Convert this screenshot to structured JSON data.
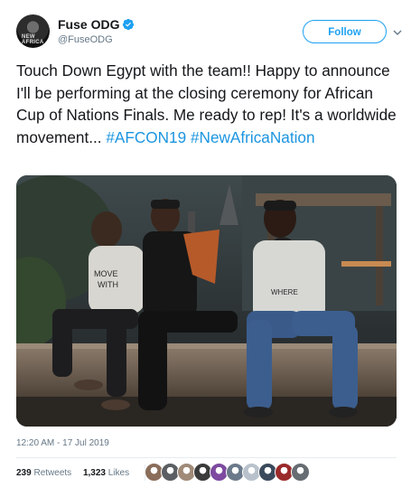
{
  "author": {
    "name": "Fuse ODG",
    "handle": "@FuseODG",
    "avatar_icon": "profile-photo-icon",
    "avatar_text": "NEW AFRICA",
    "verified_icon": "verified-badge-icon"
  },
  "follow_button": {
    "label": "Follow"
  },
  "menu": {
    "icon": "chevron-down-icon"
  },
  "tweet": {
    "text": "Touch Down Egypt with the team!! Happy to announce I'll be performing at the closing ceremony for African Cup of Nations Finals. Me ready to rep! It's a worldwide movement... ",
    "hashtags": [
      "#AFCON19",
      "#NewAfricaNation"
    ]
  },
  "photo": {
    "description_icon": "photo-three-men-sitting-on-ledge"
  },
  "meta": {
    "time": "12:20 AM - 17 Jul 2019"
  },
  "stats": {
    "retweets_count": "239",
    "retweets_label": "Retweets",
    "likes_count": "1,323",
    "likes_label": "Likes"
  },
  "likers": {
    "colors": [
      "#8a6d5a",
      "#5b5f63",
      "#a08a78",
      "#3b3b3b",
      "#7d4aa0",
      "#6b7a8a",
      "#b9c2cc",
      "#3a4a5c",
      "#9a2b2b",
      "#666d73"
    ]
  },
  "colors": {
    "accent": "#1da1f2",
    "hashtag": "#1b95e0",
    "text": "#14171a",
    "muted": "#657786"
  }
}
